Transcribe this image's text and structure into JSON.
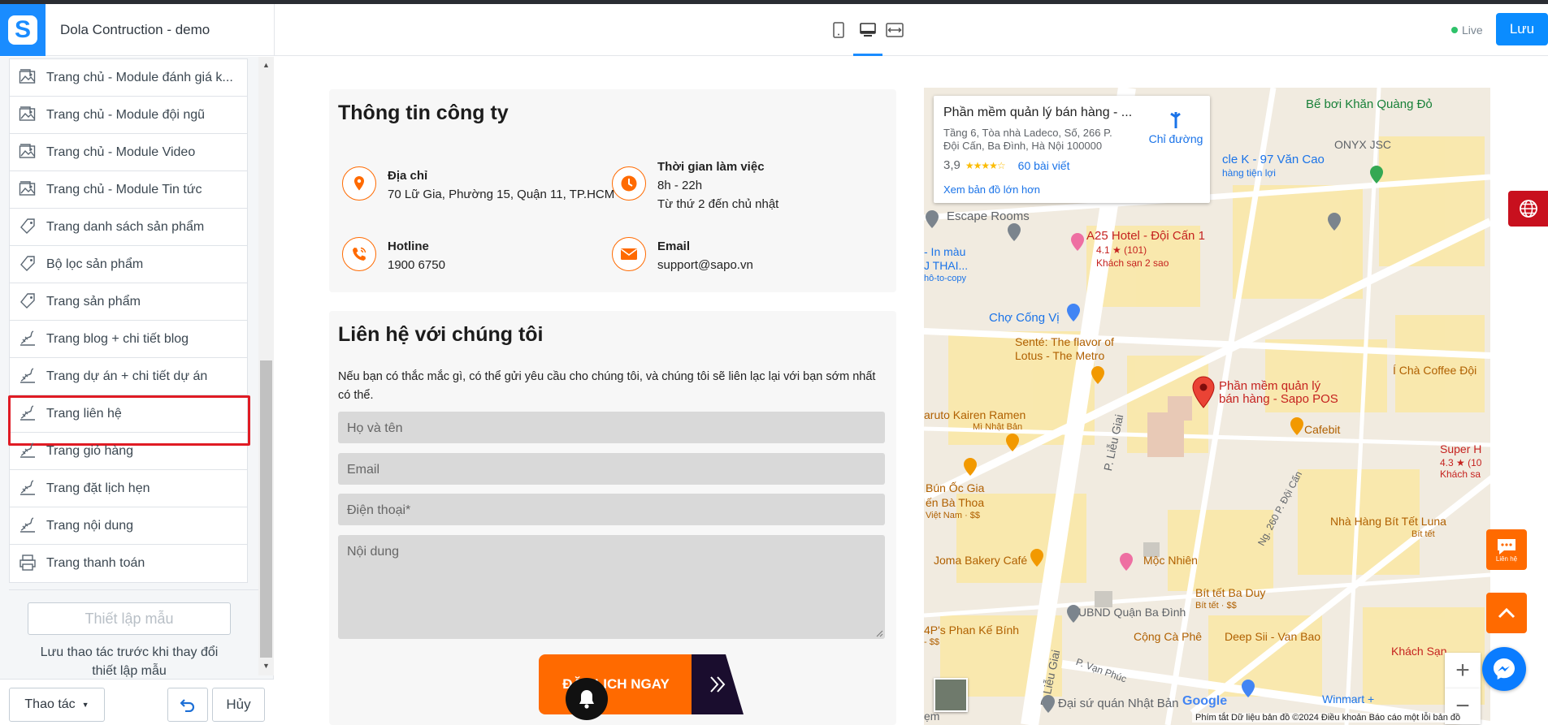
{
  "header": {
    "store_name": "Dola Contruction - demo",
    "live_label": "Live",
    "save_label": "Lưu",
    "devices": [
      "mobile-icon",
      "desktop-icon",
      "fullwidth-icon"
    ],
    "active_device": "desktop"
  },
  "sidebar": {
    "items": [
      {
        "label": "Trang chủ - Module đánh giá k...",
        "icon": "image-icon"
      },
      {
        "label": "Trang chủ - Module đội ngũ",
        "icon": "image-icon"
      },
      {
        "label": "Trang chủ - Module Video",
        "icon": "image-icon"
      },
      {
        "label": "Trang chủ - Module Tin tức",
        "icon": "image-icon"
      },
      {
        "label": "Trang danh sách sản phẩm",
        "icon": "tag-icon"
      },
      {
        "label": "Bộ lọc sản phẩm",
        "icon": "tag-icon"
      },
      {
        "label": "Trang sản phẩm",
        "icon": "tag-icon"
      },
      {
        "label": "Trang blog + chi tiết blog",
        "icon": "page-icon"
      },
      {
        "label": "Trang dự án + chi tiết dự án",
        "icon": "page-icon"
      },
      {
        "label": "Trang liên hệ",
        "icon": "page-icon",
        "active": true
      },
      {
        "label": "Trang giỏ hàng",
        "icon": "page-icon"
      },
      {
        "label": "Trang đặt lịch hẹn",
        "icon": "page-icon"
      },
      {
        "label": "Trang nội dung",
        "icon": "page-icon"
      },
      {
        "label": "Trang thanh toán",
        "icon": "printer-icon"
      }
    ],
    "template_button": "Thiết lập mẫu",
    "template_note": "Lưu thao tác trước khi thay đổi thiết lập mẫu",
    "ops_label": "Thao tác",
    "cancel_label": "Hủy"
  },
  "company_info": {
    "title": "Thông tin công ty",
    "address_label": "Địa chỉ",
    "address": "70 Lữ Gia, Phường 15, Quận 11, TP.HCM",
    "hours_label": "Thời gian làm việc",
    "hours_line1": "8h - 22h",
    "hours_line2": "Từ thứ 2 đến chủ nhật",
    "hotline_label": "Hotline",
    "hotline": "1900 6750",
    "email_label": "Email",
    "email": "support@sapo.vn"
  },
  "contact_form": {
    "title": "Liên hệ với chúng tôi",
    "description": "Nếu bạn có thắc mắc gì, có thể gửi yêu cầu cho chúng tôi, và chúng tôi sẽ liên lạc lại với bạn sớm nhất có thể.",
    "name_placeholder": "Họ và tên",
    "email_placeholder": "Email",
    "phone_placeholder": "Điện thoại*",
    "content_placeholder": "Nội dung",
    "submit_label": "ĐẶT LỊCH NGAY"
  },
  "map": {
    "place_name": "Phần mềm quản lý bán hàng - ...",
    "place_address": "Tầng 6, Tòa nhà Ladeco, Số, 266 P. Đội Cấn, Ba Đình, Hà Nội 100000",
    "rating": "3,9",
    "stars": "★★★★☆",
    "reviews": "60 bài viết",
    "larger_map": "Xem bản đồ lớn hơn",
    "directions": "Chỉ đường",
    "pin_label_1": "Phần mềm quản lý",
    "pin_label_2": "bán hàng - Sapo POS",
    "labels": [
      "Bể bơi Khăn Quàng Đỏ",
      "ONYX JSC",
      "cle K - 97 Văn Cao",
      "hàng tiện lợi",
      "Escape Rooms",
      "A25 Hotel - Đội Cấn 1",
      "4.1 ★ (101)",
      "Khách sạn 2 sao",
      "- In màu",
      "J THAI...",
      "hô-to-copy",
      "Chợ Cống Vị",
      "Senté: The flavor of",
      "Lotus - The Metro",
      "Í Chà Coffee Đội",
      "Cafebit",
      "aruto Kairen Ramen",
      "Mì Nhật Bản",
      "P. Liễu Giai",
      "Super H",
      "4.3 ★ (10",
      "Khách sa",
      "Bún Ốc Gia",
      "ến Bà Thoa",
      "Việt Nam · $$",
      "Nhà Hàng Bít Tết Luna",
      "Bít tết",
      "Ng. 260 P. Đội Cấn",
      "Joma Bakery Café",
      "Mộc Nhiên",
      "Bít tết Ba Duy",
      "Bít tết · $$",
      "UBND Quận Ba Đình",
      "4P's Phan Kế Bính",
      "- $$",
      "Cộng Cà Phê",
      "Deep Sii - Van Bao",
      "Khách Sạn",
      "P. Liễu Giai",
      "P. Vạn Phúc",
      "Winmart +",
      "Đại sứ quán Nhật Bản",
      "ẹm",
      "Google"
    ],
    "footer": "Phím tắt   Dữ liệu bản đồ ©2024   Điều khoản   Báo cáo một lỗi bản đồ"
  },
  "floating": {
    "contact_label": "Liên hệ"
  }
}
